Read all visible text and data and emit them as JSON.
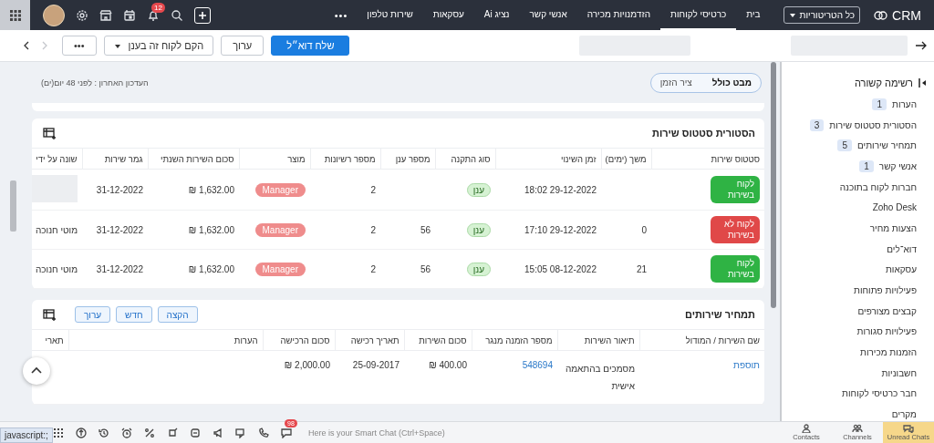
{
  "top_nav": {
    "logo": "CRM",
    "territory": "כל הטריטוריות",
    "more": "•••",
    "notification_count": "12",
    "tabs": [
      {
        "label": "בית",
        "selected": false
      },
      {
        "label": "כרטיסי לקוחות",
        "selected": true
      },
      {
        "label": "הזדמנויות מכירה",
        "selected": false
      },
      {
        "label": "אנשי קשר",
        "selected": false
      },
      {
        "label": "נציג Ai",
        "selected": false
      },
      {
        "label": "עסקאות",
        "selected": false
      },
      {
        "label": "שירות טלפון",
        "selected": false
      }
    ]
  },
  "action_bar": {
    "buttons": [
      {
        "label": "שלח דוא״ל",
        "kind": "primary"
      },
      {
        "label": "ערוך",
        "kind": "plain"
      },
      {
        "label": "הקם לקוח זה בענן",
        "kind": "dropdown"
      },
      {
        "label": "•••",
        "kind": "plain"
      }
    ]
  },
  "sidebar": {
    "title": "רשימה קשורה",
    "items": [
      {
        "label": "הערות",
        "count": "1"
      },
      {
        "label": "הסטורית סטטוס שירות",
        "count": "3"
      },
      {
        "label": "תמחיר שירותים",
        "count": "5"
      },
      {
        "label": "אנשי קשר",
        "count": "1"
      },
      {
        "label": "חברות לקוח בתוכנה"
      },
      {
        "label": "Zoho Desk"
      },
      {
        "label": "הצעות מחיר"
      },
      {
        "label": "דוא־לים"
      },
      {
        "label": "עסקאות"
      },
      {
        "label": "פעילויות פתוחות"
      },
      {
        "label": "קבצים מצורפים"
      },
      {
        "label": "פעילויות סגורות"
      },
      {
        "label": "הזמנות מכירות"
      },
      {
        "label": "חשבוניות"
      },
      {
        "label": "חבר כרטיסי לקוחות"
      },
      {
        "label": "מקרים"
      }
    ]
  },
  "view_toggle": [
    {
      "label": "מבט כולל",
      "selected": true
    },
    {
      "label": "ציר הזמן",
      "selected": false
    }
  ],
  "last_updated": "העדכון האחרון : לפני 48 יום(ים)",
  "service_status_history": {
    "title": "הסטורית סטטוס שירות",
    "columns": [
      "סטטוס שירות",
      "משך (ימים)",
      "זמן השינוי",
      "סוג התקנה",
      "מספר ענן",
      "מספר רשיונות",
      "מוצר",
      "סכום השירות השנתי",
      "גמר שירות",
      "שונה על ידי"
    ],
    "rows": [
      [
        {
          "kind": "status",
          "text": "לקוח בשירות",
          "color": "#2fb344"
        },
        {
          "kind": "empty"
        },
        {
          "kind": "text",
          "text": "29-12-2022 18:02"
        },
        {
          "kind": "tag",
          "text": "ענן"
        },
        {
          "kind": "empty"
        },
        {
          "kind": "text",
          "text": "2"
        },
        {
          "kind": "product",
          "text": "Manager"
        },
        {
          "kind": "money",
          "text": "₪ 1,632.00"
        },
        {
          "kind": "text",
          "text": "31-12-2022"
        },
        {
          "kind": "redacted"
        }
      ],
      [
        {
          "kind": "status",
          "text": "לקוח לא בשירות",
          "color": "#e04848"
        },
        {
          "kind": "text",
          "text": "0"
        },
        {
          "kind": "text",
          "text": "29-12-2022 17:10"
        },
        {
          "kind": "tag",
          "text": "ענן"
        },
        {
          "kind": "text",
          "text": "56"
        },
        {
          "kind": "text",
          "text": "2"
        },
        {
          "kind": "product",
          "text": "Manager"
        },
        {
          "kind": "money",
          "text": "₪ 1,632.00"
        },
        {
          "kind": "text",
          "text": "31-12-2022"
        },
        {
          "kind": "text",
          "text": "מוטי חנוכה"
        }
      ],
      [
        {
          "kind": "status",
          "text": "לקוח בשירות",
          "color": "#2fb344"
        },
        {
          "kind": "text",
          "text": "21"
        },
        {
          "kind": "text",
          "text": "08-12-2022 15:05"
        },
        {
          "kind": "tag",
          "text": "ענן"
        },
        {
          "kind": "text",
          "text": "56"
        },
        {
          "kind": "text",
          "text": "2"
        },
        {
          "kind": "product",
          "text": "Manager"
        },
        {
          "kind": "money",
          "text": "₪ 1,632.00"
        },
        {
          "kind": "text",
          "text": "31-12-2022"
        },
        {
          "kind": "text",
          "text": "מוטי חנוכה"
        }
      ]
    ]
  },
  "service_pricing": {
    "title": "תמחיר שירותים",
    "buttons": [
      "הקצה",
      "חדש",
      "ערוך"
    ],
    "columns": [
      "שם השירות / המודול",
      "תיאור השירות",
      "מספר הזמנה מנגר",
      "סכום השירות",
      "תאריך רכישה",
      "סכום הרכישה",
      "הערות",
      "תארי"
    ],
    "rows": [
      [
        {
          "kind": "link",
          "text": "תוספת"
        },
        {
          "kind": "text",
          "text": "מסמכים בהתאמה אישית"
        },
        {
          "kind": "link",
          "text": "548694"
        },
        {
          "kind": "money",
          "text": "₪ 400.00"
        },
        {
          "kind": "text",
          "text": "25-09-2017"
        },
        {
          "kind": "money",
          "text": "₪ 2,000.00"
        },
        {
          "kind": "empty"
        },
        {
          "kind": "empty"
        }
      ]
    ]
  },
  "chat_bar": {
    "placeholder": "Here is your Smart Chat (Ctrl+Space)",
    "badge": "98",
    "shortcuts": [
      {
        "label": "Unread Chats",
        "selected": true
      },
      {
        "label": "Channels",
        "selected": false
      },
      {
        "label": "Contacts",
        "selected": false
      }
    ]
  },
  "browser_status": "javascript:;"
}
